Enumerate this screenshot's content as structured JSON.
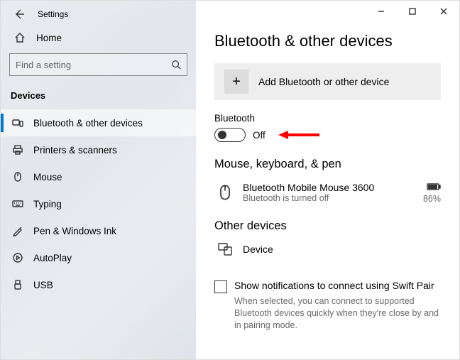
{
  "app_title": "Settings",
  "sidebar": {
    "home_label": "Home",
    "search_placeholder": "Find a setting",
    "section_header": "Devices",
    "items": [
      {
        "label": "Bluetooth & other devices"
      },
      {
        "label": "Printers & scanners"
      },
      {
        "label": "Mouse"
      },
      {
        "label": "Typing"
      },
      {
        "label": "Pen & Windows Ink"
      },
      {
        "label": "AutoPlay"
      },
      {
        "label": "USB"
      }
    ]
  },
  "page": {
    "title": "Bluetooth & other devices",
    "add_device_label": "Add Bluetooth or other device",
    "bluetooth_label": "Bluetooth",
    "toggle_state": "Off",
    "mouse_section_title": "Mouse, keyboard, & pen",
    "mouse_device": {
      "name": "Bluetooth Mobile Mouse 3600",
      "status": "Bluetooth is turned off",
      "battery_pct": "86%"
    },
    "other_section_title": "Other devices",
    "other_device_name": "Device",
    "swift_pair_label": "Show notifications to connect using Swift Pair",
    "swift_pair_desc": "When selected, you can connect to supported Bluetooth devices quickly when they're close by and in pairing mode."
  }
}
